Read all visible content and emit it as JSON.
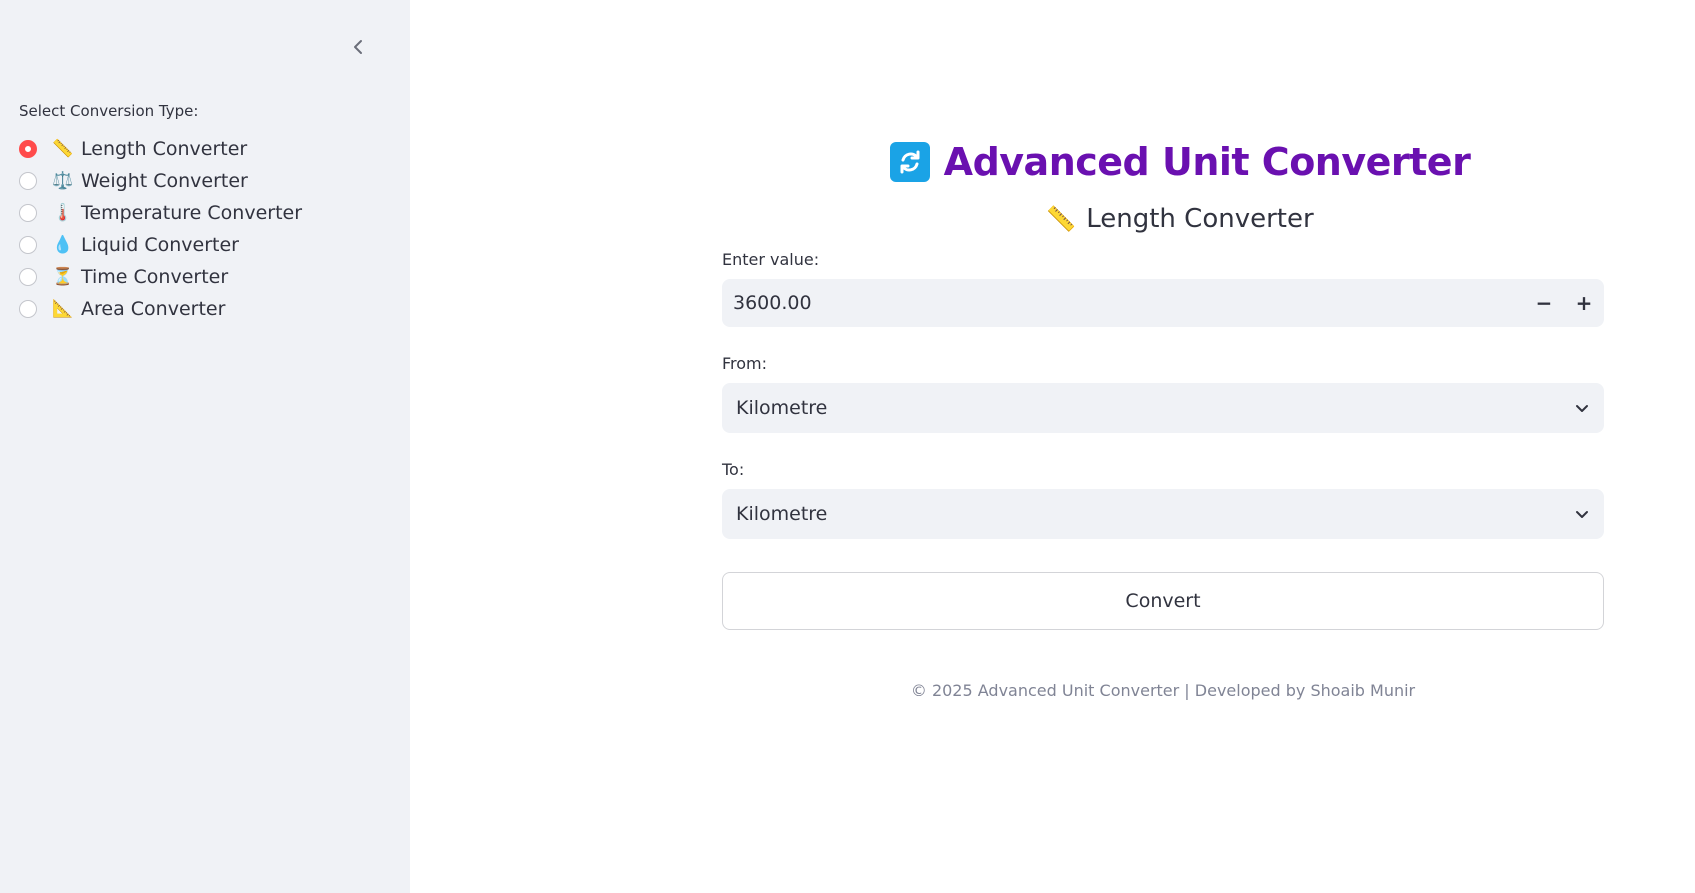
{
  "sidebar": {
    "label": "Select Conversion Type:",
    "items": [
      {
        "emoji": "📏",
        "label": "Length Converter",
        "selected": true
      },
      {
        "emoji": "⚖️",
        "label": "Weight Converter",
        "selected": false
      },
      {
        "emoji": "🌡️",
        "label": "Temperature Converter",
        "selected": false
      },
      {
        "emoji": "💧",
        "label": "Liquid Converter",
        "selected": false
      },
      {
        "emoji": "⏳",
        "label": "Time Converter",
        "selected": false
      },
      {
        "emoji": "📐",
        "label": "Area Converter",
        "selected": false
      }
    ]
  },
  "header": {
    "title": "Advanced Unit Converter",
    "subtitle_emoji": "📏",
    "subtitle": "Length Converter"
  },
  "form": {
    "value_label": "Enter value:",
    "value": "3600.00",
    "minus": "−",
    "plus": "+",
    "from_label": "From:",
    "from_value": "Kilometre",
    "to_label": "To:",
    "to_value": "Kilometre",
    "convert_label": "Convert"
  },
  "footer": {
    "text": "© 2025 Advanced Unit Converter | Developed by Shoaib Munir"
  },
  "colors": {
    "accent": "#ff4b4b",
    "title": "#6a10b0",
    "icon_bg": "#1aa3e6",
    "sidebar_bg": "#f0f2f6"
  }
}
